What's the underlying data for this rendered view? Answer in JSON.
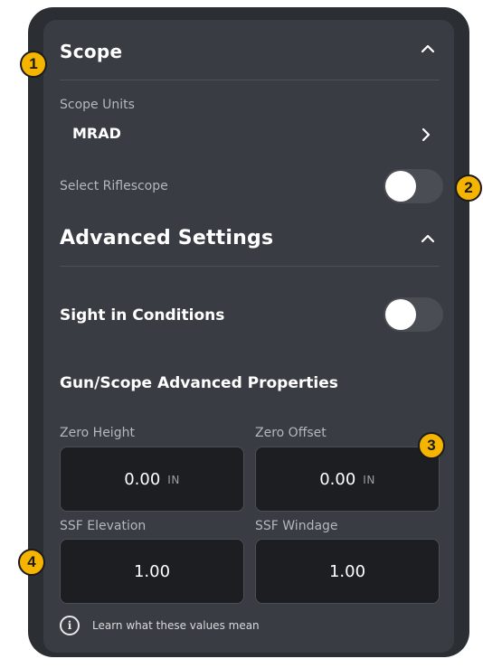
{
  "scope": {
    "title": "Scope",
    "units_label": "Scope Units",
    "units_value": "MRAD",
    "riflescope_label": "Select Riflescope",
    "riflescope_enabled": false
  },
  "advanced": {
    "title": "Advanced Settings",
    "sight_in_label": "Sight in Conditions",
    "sight_in_enabled": false,
    "properties_heading": "Gun/Scope Advanced Properties",
    "fields": [
      {
        "label": "Zero Height",
        "value": "0.00",
        "unit": "IN"
      },
      {
        "label": "Zero Offset",
        "value": "0.00",
        "unit": "IN"
      },
      {
        "label": "SSF Elevation",
        "value": "1.00"
      },
      {
        "label": "SSF Windage",
        "value": "1.00"
      }
    ],
    "learn_more": "Learn what these values mean"
  },
  "annotations": [
    "1",
    "2",
    "3",
    "4"
  ],
  "colors": {
    "panel": "#393c42",
    "field": "#1c1e22",
    "badge": "#f5b400"
  }
}
